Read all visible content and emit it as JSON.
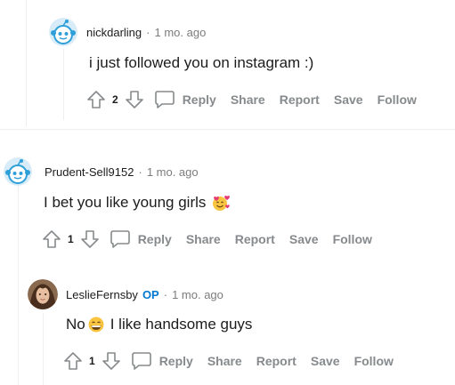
{
  "comments": [
    {
      "username": "nickdarling",
      "op_badge": "",
      "separator": "·",
      "time": "1 mo. ago",
      "body": "i just followed you on instagram :)",
      "emoji_after": "",
      "emoji_inline": "",
      "body_rest": "",
      "votes": "2"
    },
    {
      "username": "Prudent-Sell9152",
      "op_badge": "",
      "separator": "·",
      "time": "1 mo. ago",
      "body": "I bet you like young girls",
      "emoji_after": "smiling-face-with-hearts",
      "emoji_inline": "",
      "body_rest": "",
      "votes": "1"
    },
    {
      "username": "LeslieFernsby",
      "op_badge": "OP",
      "separator": "·",
      "time": "1 mo. ago",
      "body": "No",
      "emoji_inline": "grinning-face",
      "body_rest": "I like handsome guys",
      "emoji_after": "",
      "votes": "1"
    }
  ],
  "actions": {
    "reply": "Reply",
    "share": "Share",
    "report": "Report",
    "save": "Save",
    "follow": "Follow"
  },
  "colors": {
    "text": "#1c1c1c",
    "meta": "#7c7c7c",
    "action": "#878a8c",
    "op": "#0079d3",
    "snoo": "#2e9fd8"
  }
}
